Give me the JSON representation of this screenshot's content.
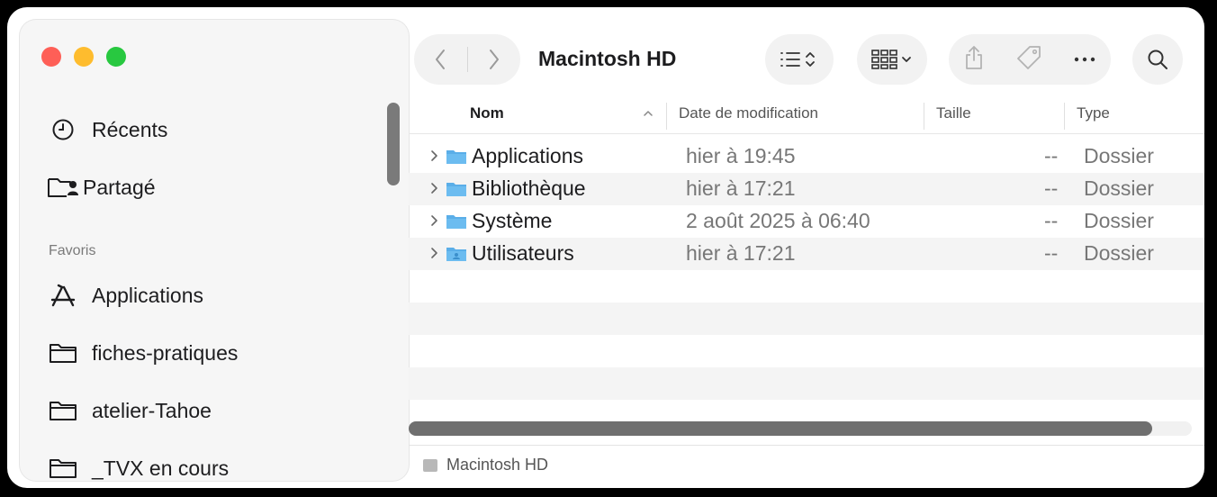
{
  "window": {
    "title": "Macintosh HD"
  },
  "sidebar": {
    "items_top": [
      {
        "label": "Récents",
        "icon": "clock-icon"
      },
      {
        "label": "Partagé",
        "icon": "shared-folder-icon"
      }
    ],
    "favorites_label": "Favoris",
    "favorites": [
      {
        "label": "Applications",
        "icon": "applications-icon"
      },
      {
        "label": "fiches-pratiques",
        "icon": "folder-icon"
      },
      {
        "label": "atelier-Tahoe",
        "icon": "folder-icon"
      },
      {
        "label": "_TVX en cours",
        "icon": "folder-icon"
      }
    ]
  },
  "columns": {
    "name": "Nom",
    "date": "Date de modification",
    "size": "Taille",
    "type": "Type"
  },
  "rows": [
    {
      "name": "Applications",
      "date": "hier à 19:45",
      "size": "--",
      "type": "Dossier"
    },
    {
      "name": "Bibliothèque",
      "date": "hier à 17:21",
      "size": "--",
      "type": "Dossier"
    },
    {
      "name": "Système",
      "date": "2 août 2025 à 06:40",
      "size": "--",
      "type": "Dossier"
    },
    {
      "name": "Utilisateurs",
      "date": "hier à 17:21",
      "size": "--",
      "type": "Dossier"
    }
  ],
  "pathbar": {
    "label": "Macintosh HD"
  },
  "colors": {
    "close": "#fe5f57",
    "minimize": "#febc2e",
    "zoom": "#28c840",
    "folder": "#5aaee8"
  }
}
